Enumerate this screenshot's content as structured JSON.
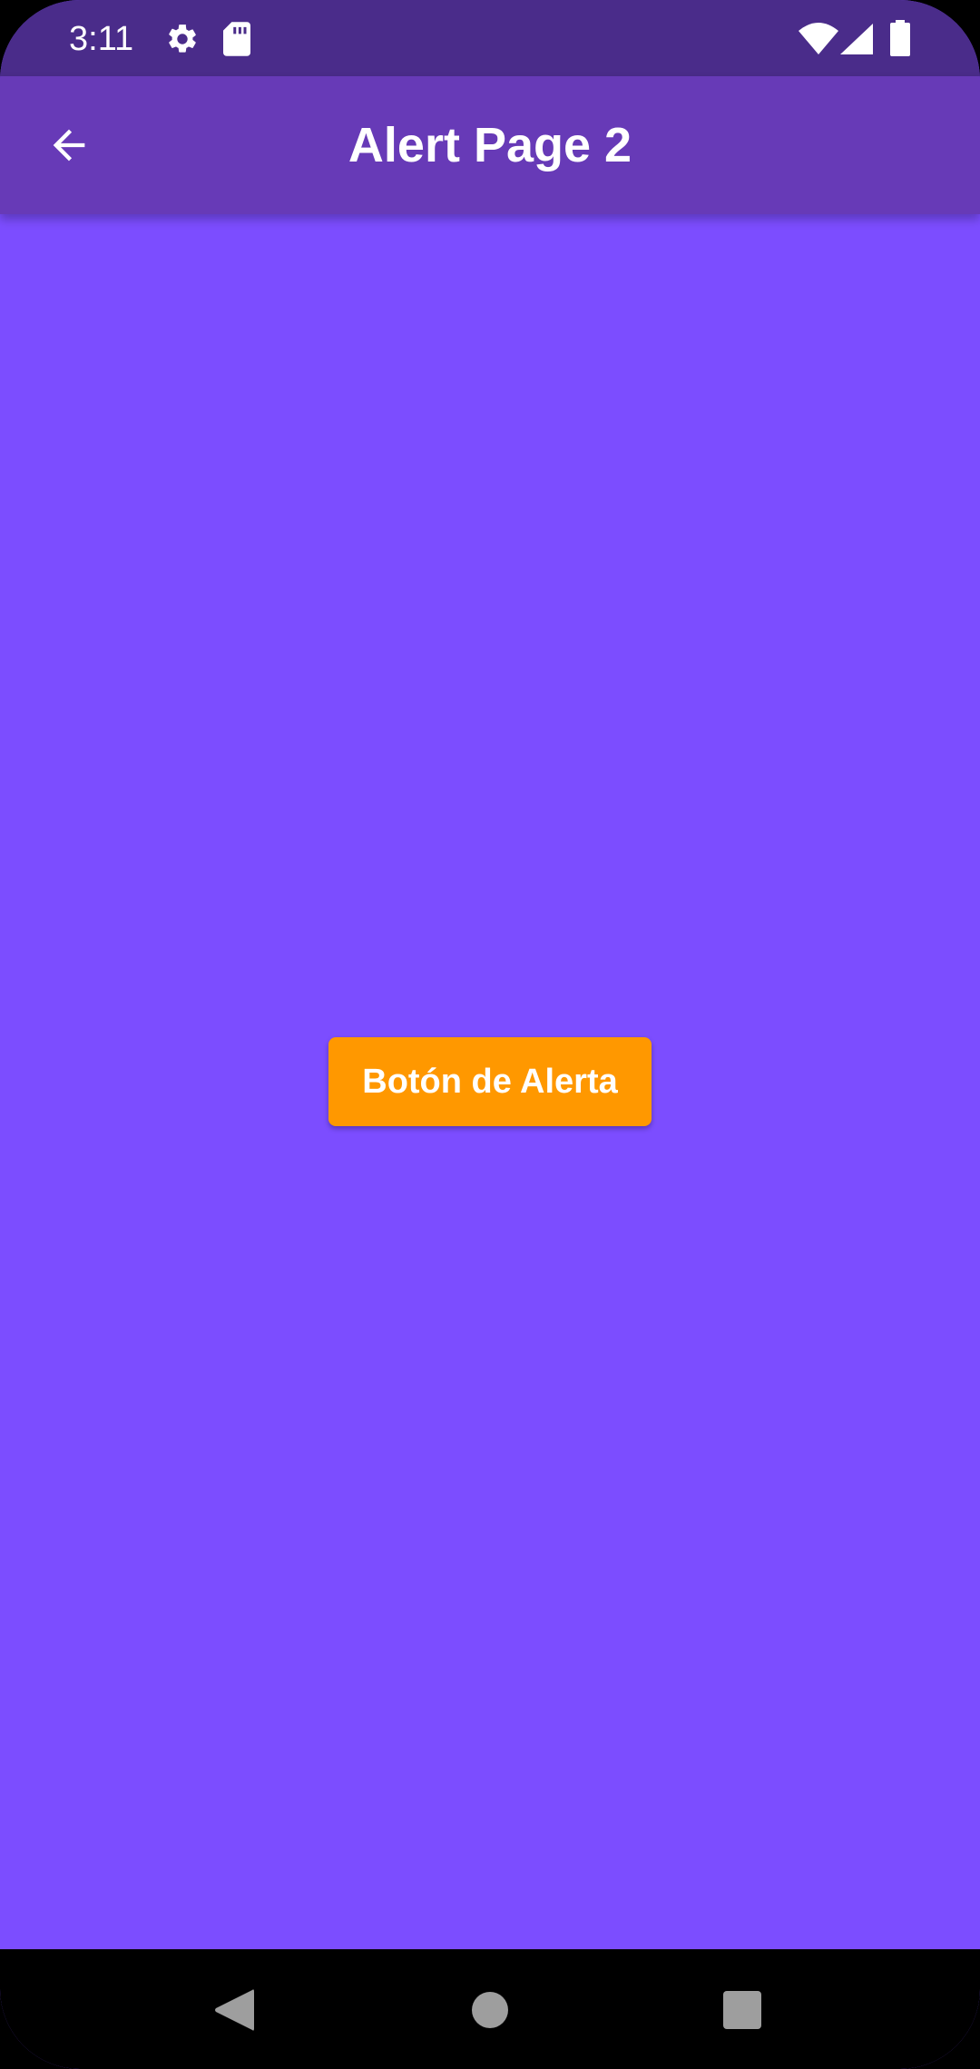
{
  "status_bar": {
    "time": "3:11",
    "icons": [
      "gear-icon",
      "sd-card-icon",
      "wifi-icon",
      "cell-signal-icon",
      "battery-icon"
    ]
  },
  "app_bar": {
    "title": "Alert Page 2",
    "back_icon": "arrow-back-icon"
  },
  "main": {
    "alert_button_label": "Botón de Alerta"
  },
  "nav_bar": {
    "icons": [
      "back-triangle-icon",
      "home-circle-icon",
      "recents-square-icon"
    ]
  },
  "colors": {
    "status_bar": "#4a2c8a",
    "app_bar": "#673ab7",
    "background": "#7c4dff",
    "button": "#ff9800",
    "nav_bar": "#000000"
  }
}
